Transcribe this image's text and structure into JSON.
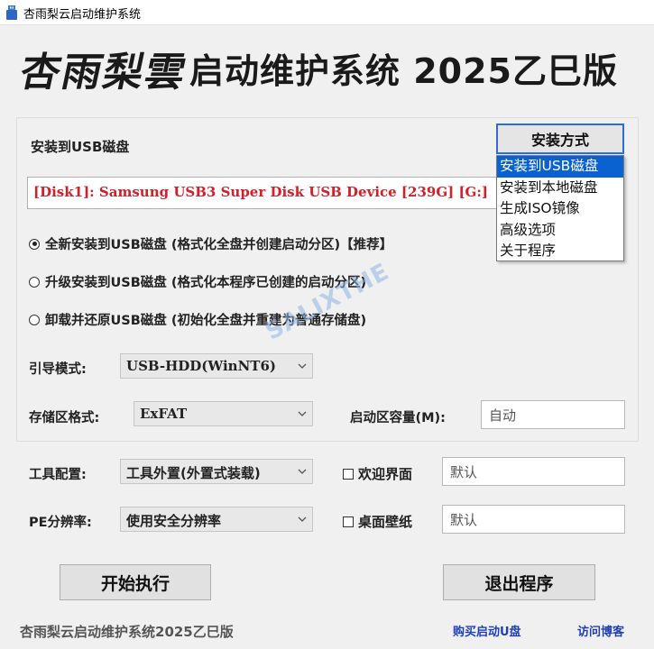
{
  "window": {
    "title": "杏雨梨云启动维护系统"
  },
  "banner": {
    "script_text": "杏雨梨雲",
    "rest_text": "启动维护系统 2025乙巳版"
  },
  "install_target": {
    "label": "安装到USB磁盘",
    "disk_value": "[Disk1]:  Samsung USB3 Super Disk USB Device  [239G]  [G:]"
  },
  "install_modes": [
    {
      "label": "全新安装到USB磁盘 (格式化全盘并创建启动分区)【推荐】",
      "checked": true
    },
    {
      "label": "升级安装到USB磁盘 (格式化本程序已创建的启动分区)",
      "checked": false
    },
    {
      "label": "卸载并还原USB磁盘 (初始化全盘并重建为普通存储盘)",
      "checked": false
    }
  ],
  "boot_mode": {
    "label": "引导模式:",
    "value": "USB-HDD(WinNT6)"
  },
  "storage_format": {
    "label": "存储区格式:",
    "value": "ExFAT"
  },
  "boot_capacity": {
    "label": "启动区容量(M):",
    "value": "自动"
  },
  "tool_config": {
    "label": "工具配置:",
    "value": "工具外置(外置式装载)"
  },
  "pe_resolution": {
    "label": "PE分辨率:",
    "value": "使用安全分辨率"
  },
  "welcome": {
    "label": "欢迎界面",
    "value": "默认"
  },
  "wallpaper": {
    "label": "桌面壁纸",
    "value": "默认"
  },
  "buttons": {
    "start": "开始执行",
    "exit": "退出程序"
  },
  "footer": {
    "text": "杏雨梨云启动维护系统2025乙巳版",
    "buy_link": "购买启动U盘",
    "blog_link": "访问博客"
  },
  "mode_menu": {
    "button_label": "安装方式",
    "items": [
      "安装到USB磁盘",
      "安装到本地磁盘",
      "生成ISO镜像",
      "高级选项",
      "关于程序"
    ],
    "selected_index": 0
  },
  "watermark": "SALIXTHE",
  "colors": {
    "accent": "#0a62d0",
    "disk_text": "#d0202a",
    "link": "#1f3fb8"
  },
  "icons": {
    "app": "usb-drive-icon",
    "chevron": "chevron-down-icon"
  }
}
